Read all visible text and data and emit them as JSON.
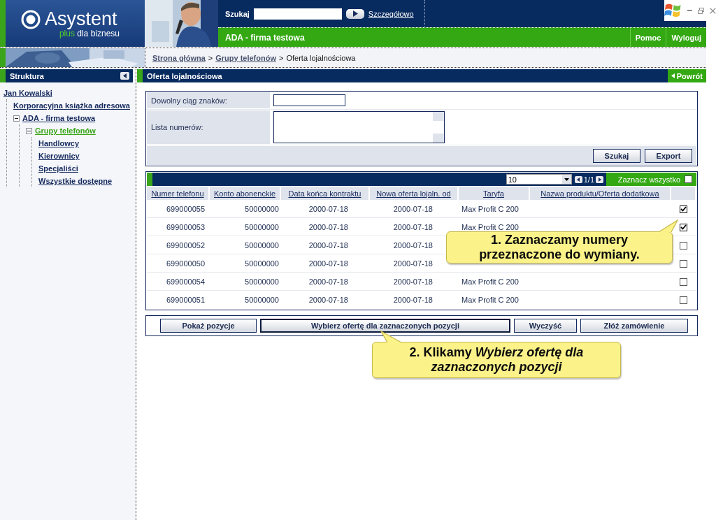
{
  "header": {
    "logo": {
      "title": "Asystent",
      "tagline_accent": "plus",
      "tagline": "dla biznesu"
    },
    "search": {
      "label": "Szukaj",
      "link": "Szczegółowo"
    },
    "company": "ADA - firma testowa",
    "menu": [
      "Pomoc",
      "Wyloguj"
    ]
  },
  "breadcrumb": [
    {
      "kind": "link",
      "text": "Strona główna"
    },
    {
      "kind": "separator",
      "text": ">"
    },
    {
      "kind": "link",
      "text": "Grupy telefonów"
    },
    {
      "kind": "separator",
      "text": ">"
    },
    {
      "kind": "current",
      "text": "Oferta lojalnościowa"
    }
  ],
  "sidebar": {
    "title": "Struktura",
    "tree": [
      {
        "label": "Jan Kowalski",
        "selected": false,
        "children": [
          {
            "label": "Korporacyjna książka adresowa",
            "selected": false
          },
          {
            "label": "ADA - firma testowa",
            "selected": false,
            "expanded": true,
            "children": [
              {
                "label": "Grupy telefonów",
                "selected": true,
                "expanded": true,
                "children": [
                  {
                    "label": "Handlowcy",
                    "selected": false
                  },
                  {
                    "label": "Kierownicy",
                    "selected": false
                  },
                  {
                    "label": "Specjaliści",
                    "selected": false
                  },
                  {
                    "label": "Wszystkie dostępne",
                    "selected": false
                  }
                ]
              }
            ]
          }
        ]
      }
    ]
  },
  "page": {
    "title": "Oferta lojalnościowa",
    "back": "Powrót"
  },
  "filter": {
    "fields": [
      {
        "label": "Dowolny ciąg znaków:",
        "kind": "input"
      },
      {
        "label": "Lista numerów:",
        "kind": "textarea"
      }
    ],
    "buttons": [
      "Szukaj",
      "Export"
    ]
  },
  "table": {
    "page_size": "10",
    "pager": "1/1",
    "select_all": {
      "label": "Zaznacz wszystko",
      "checked": false
    },
    "columns": [
      "Numer telefonu",
      "Konto abonenckie",
      "Data końca kontraktu",
      "Nowa oferta lojaln. od",
      "Taryfa",
      "Nazwa produktu/Oferta dodatkowa"
    ],
    "rows": [
      {
        "numer": "699000055",
        "konto": "50000000",
        "data_konca": "2000-07-18",
        "nowa_oferta": "2000-07-18",
        "taryfa": "Max Profit C 200",
        "checked": true
      },
      {
        "numer": "699000053",
        "konto": "50000000",
        "data_konca": "2000-07-18",
        "nowa_oferta": "2000-07-18",
        "taryfa": "Max Profit C 200",
        "checked": true
      },
      {
        "numer": "699000052",
        "konto": "50000000",
        "data_konca": "2000-07-18",
        "nowa_oferta": "2000-07-18",
        "checked": false
      },
      {
        "numer": "699000050",
        "konto": "50000000",
        "data_konca": "2000-07-18",
        "nowa_oferta": "2000-07-18",
        "checked": false
      },
      {
        "numer": "699000054",
        "konto": "50000000",
        "data_konca": "2000-07-18",
        "nowa_oferta": "2000-07-18",
        "taryfa": "Max Profit C 200",
        "checked": false
      },
      {
        "numer": "699000051",
        "konto": "50000000",
        "data_konca": "2000-07-18",
        "nowa_oferta": "2000-07-18",
        "taryfa": "Max Profit C 200",
        "checked": false
      }
    ]
  },
  "actions": [
    {
      "label": "Pokaż pozycje",
      "focused": false
    },
    {
      "label": "Wybierz ofertę dla zaznaczonych pozycji",
      "focused": true
    },
    {
      "label": "Wyczyść",
      "focused": false
    },
    {
      "label": "Złóż zamówienie",
      "focused": false
    }
  ],
  "callouts": [
    {
      "kind": "rows",
      "text": "1. Zaznaczamy numery przeznaczone do wymiany."
    },
    {
      "kind": "button",
      "text": "2. Klikamy *Wybierz ofertę dla zaznaczonych pozycji*"
    }
  ]
}
